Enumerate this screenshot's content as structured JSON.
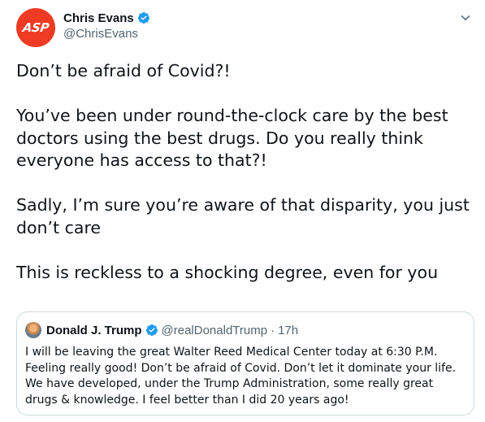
{
  "tweet": {
    "avatar_text": "ASP",
    "display_name": "Chris Evans",
    "handle": "@ChrisEvans",
    "text": "Don’t be afraid of Covid?!\n\nYou’ve been under round-the-clock care by the best doctors using the best drugs. Do you really think everyone has access to that?!\n\nSadly, I’m sure you’re aware of that disparity, you just don’t care\n\nThis is reckless to a shocking degree, even for you"
  },
  "quoted_tweet": {
    "display_name": "Donald J. Trump",
    "handle": "@realDonaldTrump",
    "separator": "·",
    "time": "17h",
    "text": "I will be leaving the great Walter Reed Medical Center today at 6:30 P.M. Feeling really good! Don’t be afraid of Covid. Don’t let it dominate your life. We have developed, under the Trump Administration, some really great drugs & knowledge. I feel better than I did 20 years ago!"
  },
  "icons": {
    "verified": "verified-badge-icon",
    "more": "chevron-down-icon"
  },
  "colors": {
    "avatar_bg": "#ef3b24",
    "verified": "#1d9bf0",
    "secondary_text": "#536471",
    "border": "#cfd9de"
  }
}
